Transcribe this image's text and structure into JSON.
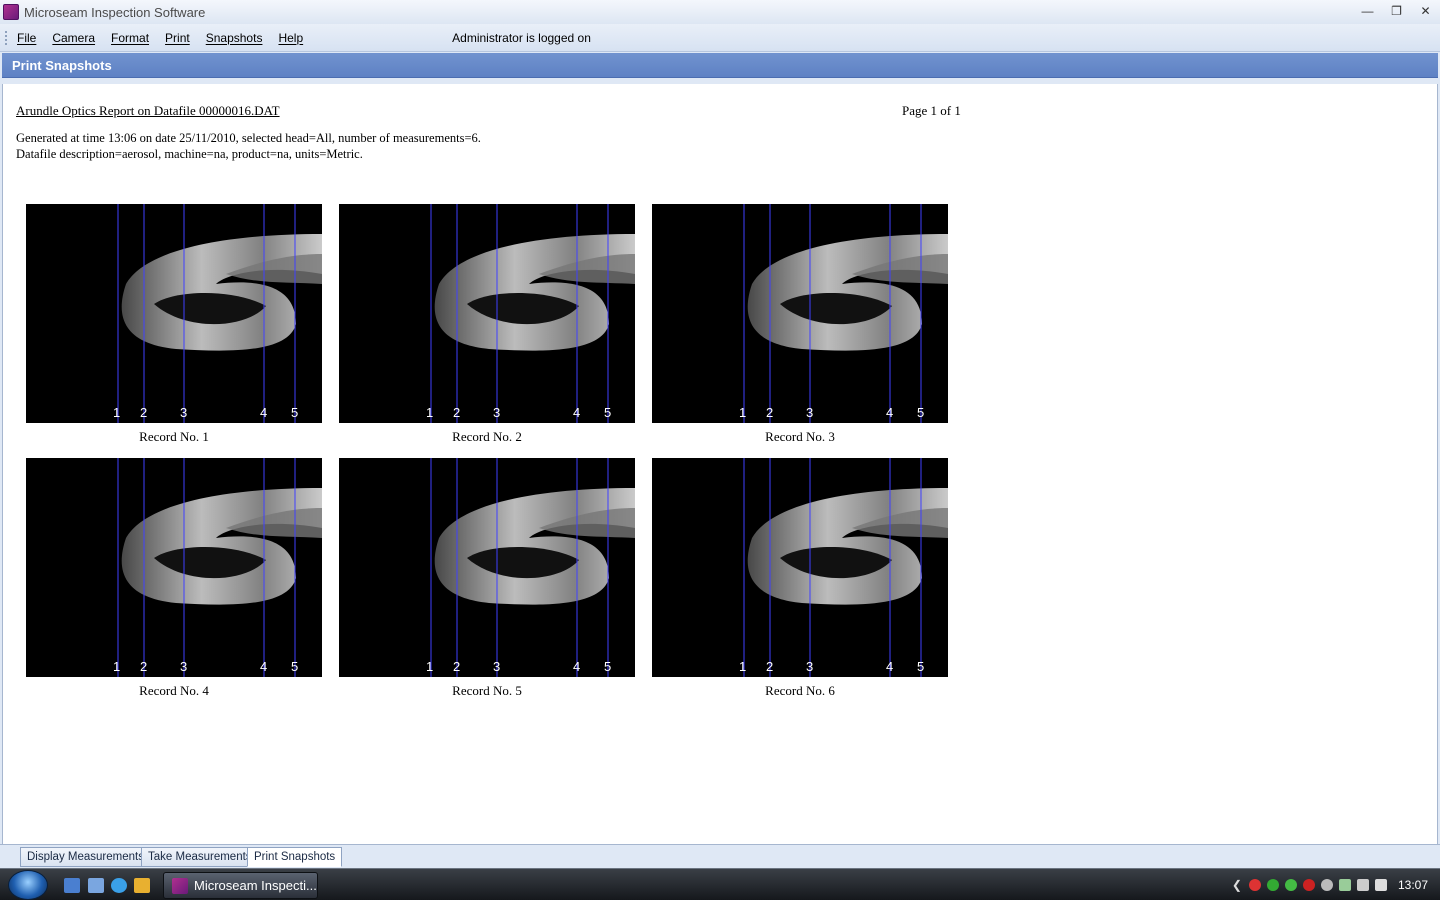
{
  "window": {
    "title": "Microseam Inspection Software"
  },
  "menu": {
    "items": [
      {
        "label": "File"
      },
      {
        "label": "Camera"
      },
      {
        "label": "Format"
      },
      {
        "label": "Print"
      },
      {
        "label": "Snapshots"
      },
      {
        "label": "Help"
      }
    ],
    "status": "Administrator is logged on"
  },
  "section": {
    "title": "Print Snapshots"
  },
  "report": {
    "title": "Arundle Optics Report on Datafile 00000016.DAT",
    "page": "Page 1 of 1",
    "line1": "Generated at time 13:06 on date 25/11/2010, selected head=All, number of measurements=6.",
    "line2": "Datafile description=aerosol, machine=na, product=na, units=Metric."
  },
  "snapshots": {
    "marker_labels": [
      "1",
      "2",
      "3",
      "4",
      "5"
    ],
    "captions": [
      "Record No. 1",
      "Record No. 2",
      "Record No. 3",
      "Record No. 4",
      "Record No. 5",
      "Record No. 6"
    ]
  },
  "tabs": [
    "Display Measurements",
    "Take Measurements",
    "Print Snapshots"
  ],
  "taskbar": {
    "app_button": "Microseam Inspecti...",
    "clock": "13:07"
  },
  "colors": {
    "header": "#6688cc",
    "marker_line": "#4040ff"
  }
}
